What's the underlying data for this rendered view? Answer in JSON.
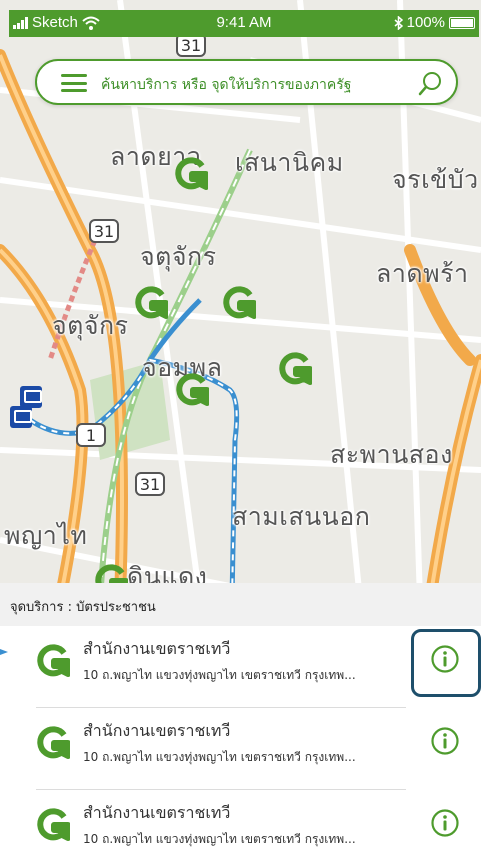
{
  "status_bar": {
    "carrier": "Sketch",
    "time": "9:41 AM",
    "battery": "100%"
  },
  "search": {
    "placeholder": "ค้นหาบริการ หรือ จุดให้บริการของภาครัฐ"
  },
  "map": {
    "labels": [
      {
        "text": "ลาดยาว"
      },
      {
        "text": "เสนานิคม"
      },
      {
        "text": "จรเข้บัว"
      },
      {
        "text": "จตุจักร"
      },
      {
        "text": "ลาดพร้า"
      },
      {
        "text": "จตุจักร"
      },
      {
        "text": "จอมพล"
      },
      {
        "text": "สะพานสอง"
      },
      {
        "text": "สามเสนนอก"
      },
      {
        "text": "พญาไท"
      },
      {
        "text": "ดินแดง"
      }
    ],
    "road_shields": [
      "31",
      "1",
      "31",
      "31"
    ]
  },
  "sheet": {
    "title": "จุดบริการ : บัตรประชาชน",
    "items": [
      {
        "name": "สำนักงานเขตราชเทวี",
        "address": "10 ถ.พญาไท แขวงทุ่งพญาไท เขตราชเทวี กรุงเทพ..."
      },
      {
        "name": "สำนักงานเขตราชเทวี",
        "address": "10 ถ.พญาไท แขวงทุ่งพญาไท เขตราชเทวี กรุงเทพ..."
      },
      {
        "name": "สำนักงานเขตราชเทวี",
        "address": "10 ถ.พญาไท แขวงทุ่งพญาไท เขตราชเทวี กรุงเทพ..."
      }
    ]
  },
  "colors": {
    "brand_green": "#4e9b2d",
    "highlight_border": "#1e4f6b",
    "map_road_orange": "#f2a94a",
    "map_transit_blue": "#3a8fd0"
  },
  "icons": [
    "signal-icon",
    "wifi-icon",
    "bluetooth-icon",
    "battery-icon",
    "menu-icon",
    "search-icon",
    "gcenter-logo-icon",
    "info-icon",
    "bus-stop-icon"
  ]
}
